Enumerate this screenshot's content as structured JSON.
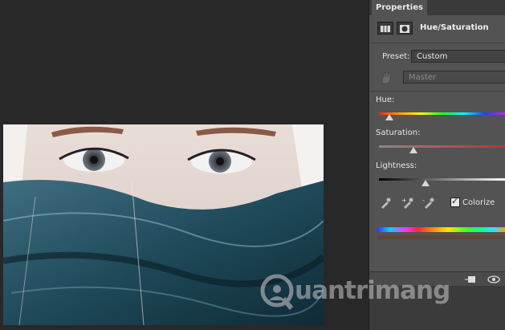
{
  "panel": {
    "tab_label": "Properties",
    "adjustment_title": "Hue/Saturation",
    "preset_label": "Preset:",
    "preset_value": "Custom",
    "channel_value": "Master",
    "hue_label": "Hue:",
    "saturation_label": "Saturation:",
    "lightness_label": "Lightness:",
    "colorize_label": "Colorize",
    "colorize_checked": true
  },
  "adjustments": {
    "hue": 0.08,
    "saturation": 0.27,
    "lightness": 0.37
  },
  "watermark": {
    "text": "uantrimang"
  },
  "colors": {
    "panel_bg": "#535353",
    "canvas_bg": "#282828",
    "hue_track": "rainbow",
    "saturation_track": "#b03a3a",
    "lightness_track_dark": "#000000",
    "lightness_track_light": "#ffffff"
  }
}
